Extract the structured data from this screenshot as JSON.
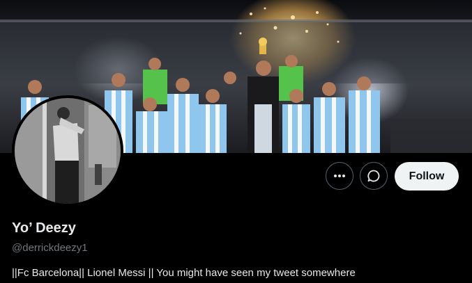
{
  "profile": {
    "display_name": "Yo’ Deezy",
    "handle": "@derrickdeezy1",
    "bio": "||Fc Barcelona|| Lionel Messi || You might have seen my tweet somewhere"
  },
  "actions": {
    "more_icon": "more-horizontal-icon",
    "message_icon": "chat-bubble-icon",
    "follow_label": "Follow"
  },
  "colors": {
    "background": "#000000",
    "follow_button_bg": "#eff3f4",
    "handle_text": "#71767b",
    "button_border": "#536471"
  }
}
